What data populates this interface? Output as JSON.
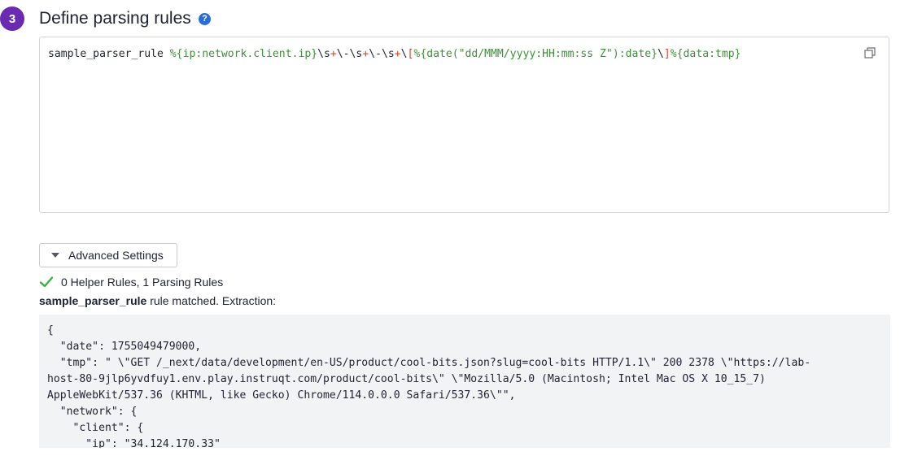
{
  "step": {
    "number": "3",
    "title": "Define parsing rules",
    "help_icon": "?"
  },
  "rules_editor": {
    "rule_name": "sample_parser_rule",
    "segments": [
      {
        "text": " ",
        "kind": "name"
      },
      {
        "text": "%{ip:network.client.ip}",
        "kind": "pat"
      },
      {
        "text": "\\s",
        "kind": "esc"
      },
      {
        "text": "+",
        "kind": "op"
      },
      {
        "text": "\\-\\s",
        "kind": "esc"
      },
      {
        "text": "+",
        "kind": "op"
      },
      {
        "text": "\\-\\s",
        "kind": "esc"
      },
      {
        "text": "+",
        "kind": "op"
      },
      {
        "text": "\\",
        "kind": "esc"
      },
      {
        "text": "[",
        "kind": "brk"
      },
      {
        "text": "%{date(\"dd/MMM/yyyy:HH:mm:ss Z\"):date}",
        "kind": "pat"
      },
      {
        "text": "\\",
        "kind": "esc"
      },
      {
        "text": "]",
        "kind": "brk"
      },
      {
        "text": "%{data:tmp}",
        "kind": "pat"
      }
    ],
    "copy_icon": "copy-icon"
  },
  "advanced_settings": {
    "label": "Advanced Settings"
  },
  "status": {
    "text": "0 Helper Rules, 1 Parsing Rules",
    "color": "#3fae49"
  },
  "match": {
    "rule": "sample_parser_rule",
    "suffix": " rule matched. Extraction:"
  },
  "output": {
    "lines": [
      "{",
      "  \"date\": 1755049479000,",
      "  \"tmp\": \" \\\"GET /_next/data/development/en-US/product/cool-bits.json?slug=cool-bits HTTP/1.1\\\" 200 2378 \\\"https://lab-",
      "host-80-9jlp6yvdfuy1.env.play.instruqt.com/product/cool-bits\\\" \\\"Mozilla/5.0 (Macintosh; Intel Mac OS X 10_15_7)",
      "AppleWebKit/537.36 (KHTML, like Gecko) Chrome/114.0.0.0 Safari/537.36\\\"\",",
      "  \"network\": {",
      "    \"client\": {",
      "      \"ip\": \"34.124.170.33\""
    ]
  },
  "colors": {
    "step_badge": "#6a2bb0",
    "help_icon": "#2c6dd1",
    "pattern": "#3f8f3a",
    "operator": "#d9482b",
    "check": "#3fae49",
    "output_bg": "#f2f3f5"
  }
}
